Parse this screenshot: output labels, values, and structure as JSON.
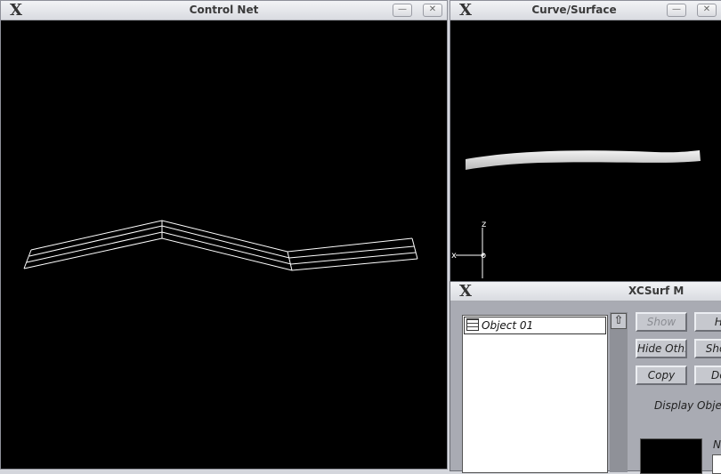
{
  "control_net": {
    "title": "Control Net",
    "minimize": "—",
    "close": "✕"
  },
  "curve_surface": {
    "title": "Curve/Surface",
    "minimize": "—",
    "close": "✕",
    "axis_z": "z",
    "axis_x": "x",
    "axis_y": "o"
  },
  "xcsurf": {
    "title": "XCSurf M",
    "object_list": [
      {
        "label": "Object 01"
      }
    ],
    "scroll_up": "⇧",
    "buttons": {
      "show": "Show",
      "hide": "Hi",
      "hide_others": "Hide Oth.",
      "show_all": "Show",
      "copy": "Copy",
      "delete": "Del"
    },
    "display_label": "Display Objec",
    "name_label": "N"
  },
  "logo_glyph": "X"
}
